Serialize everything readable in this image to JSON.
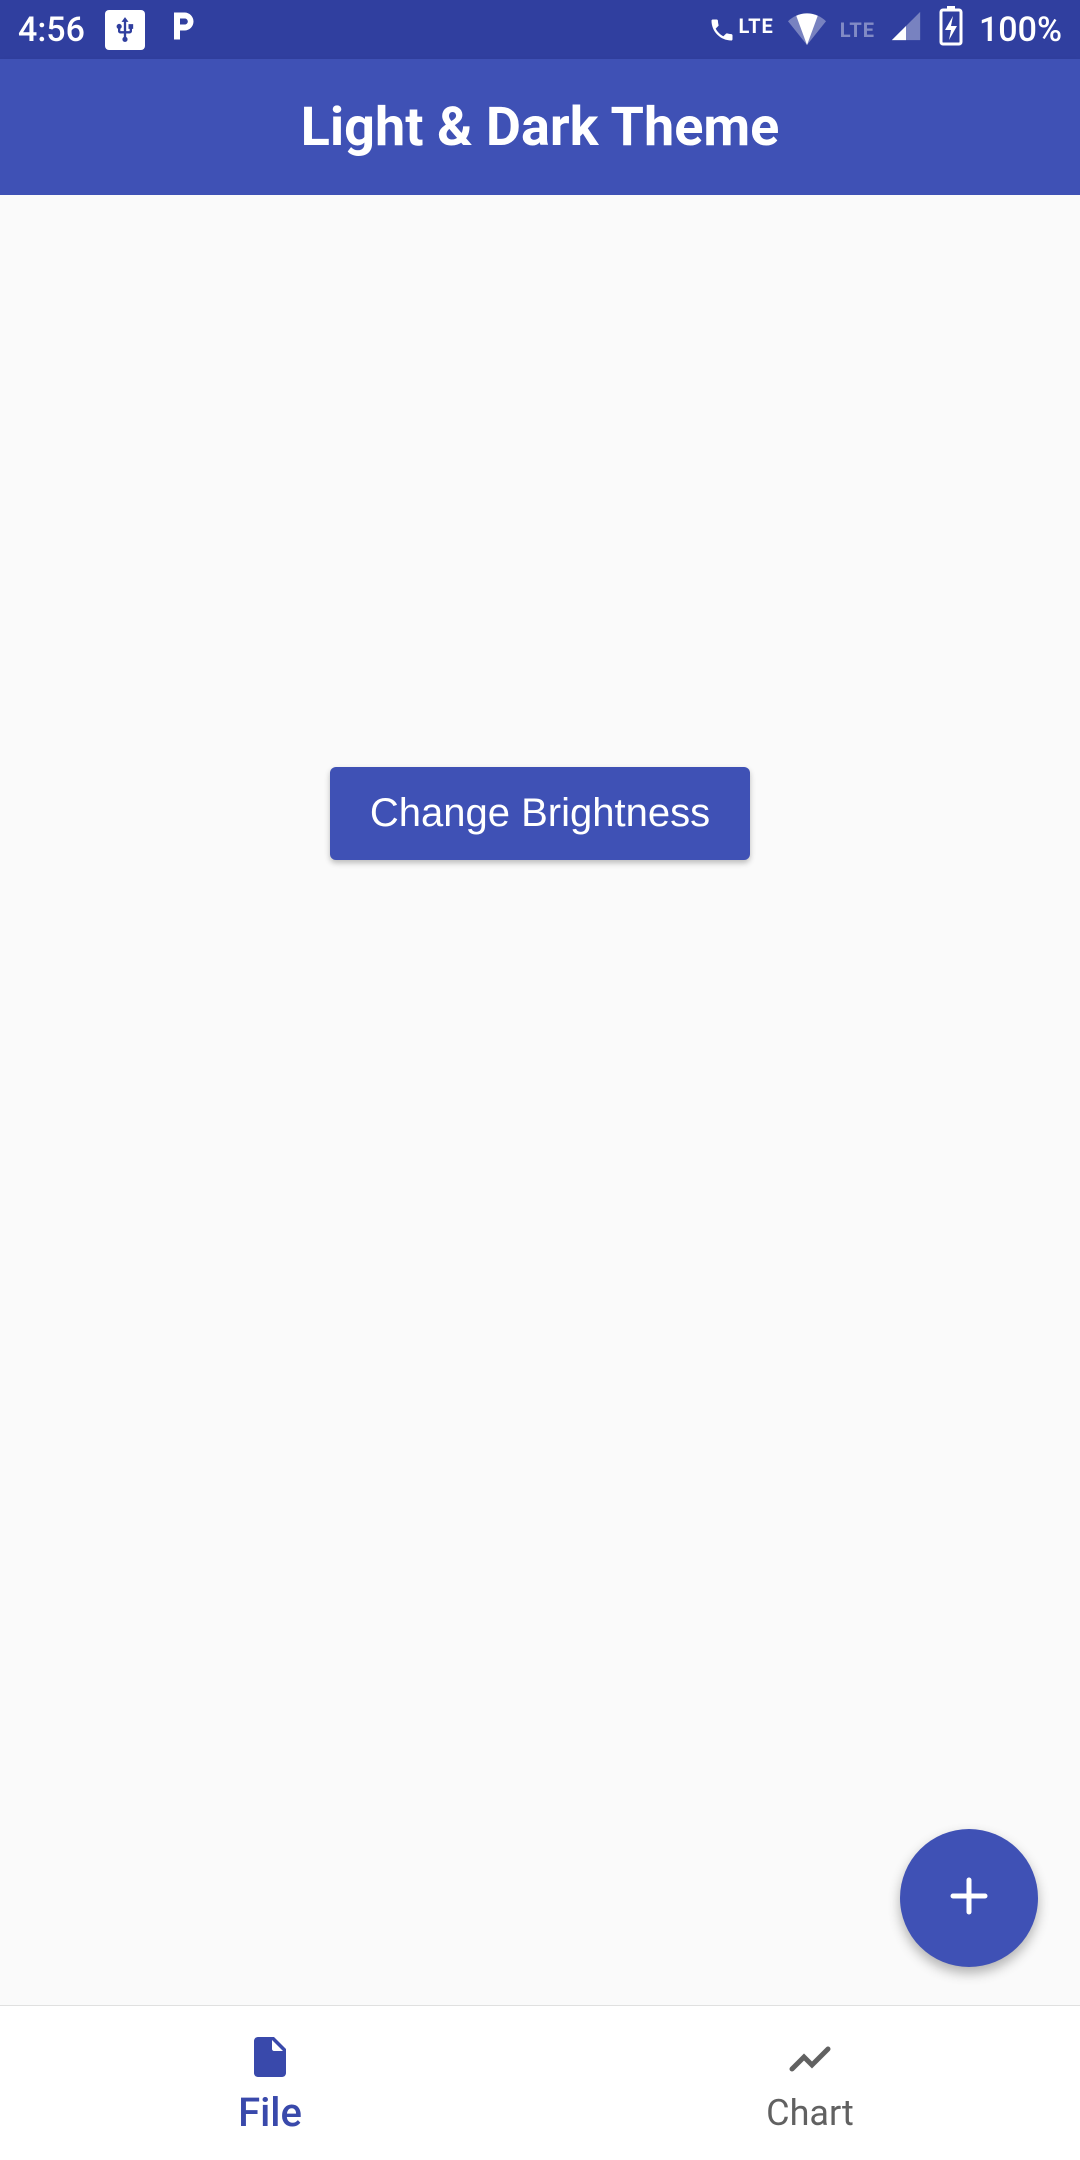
{
  "status_bar": {
    "time": "4:56",
    "battery": "100%",
    "lte_label": "LTE"
  },
  "app_bar": {
    "title": "Light & Dark Theme"
  },
  "main": {
    "change_brightness_label": "Change Brightness"
  },
  "bottom_nav": {
    "items": [
      {
        "label": "File",
        "active": true
      },
      {
        "label": "Chart",
        "active": false
      }
    ]
  },
  "colors": {
    "primary": "#3f51b5",
    "primary_dark": "#303f9f",
    "inactive": "#616161",
    "background": "#fafafa"
  }
}
